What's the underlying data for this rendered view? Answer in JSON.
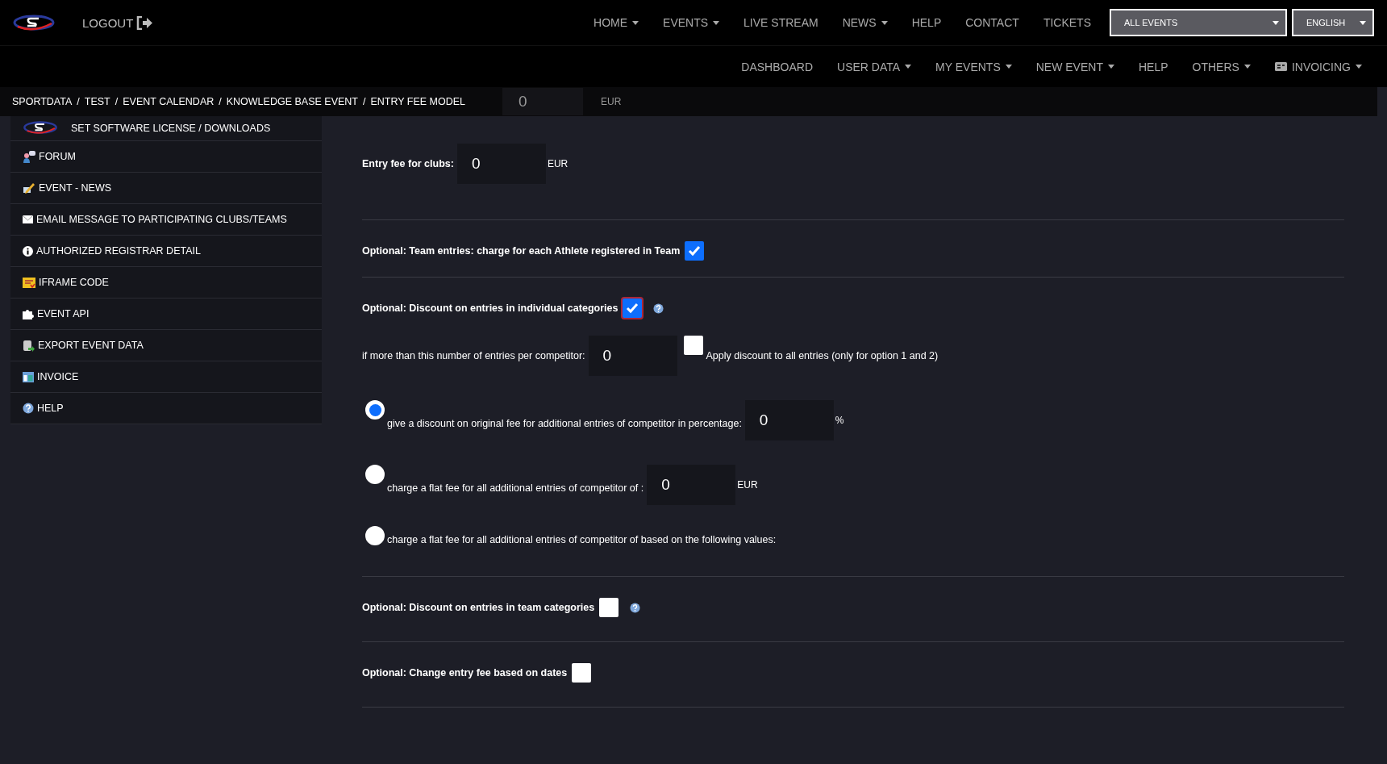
{
  "top_nav": {
    "logout": "LOGOUT",
    "items": [
      {
        "label": "HOME",
        "dropdown": true
      },
      {
        "label": "EVENTS",
        "dropdown": true
      },
      {
        "label": "LIVE STREAM",
        "dropdown": false
      },
      {
        "label": "NEWS",
        "dropdown": true
      },
      {
        "label": "HELP",
        "dropdown": false
      },
      {
        "label": "CONTACT",
        "dropdown": false
      },
      {
        "label": "TICKETS",
        "dropdown": false
      }
    ],
    "event_select": "ALL EVENTS",
    "language_select": "ENGLISH"
  },
  "sub_nav": [
    {
      "label": "DASHBOARD",
      "dropdown": false
    },
    {
      "label": "USER DATA",
      "dropdown": true
    },
    {
      "label": "MY EVENTS",
      "dropdown": true
    },
    {
      "label": "NEW EVENT",
      "dropdown": true
    },
    {
      "label": "HELP",
      "dropdown": false
    },
    {
      "label": "OTHERS",
      "dropdown": true
    },
    {
      "label": "INVOICING",
      "dropdown": true,
      "kind": "invoice"
    }
  ],
  "breadcrumb_separator": "/",
  "breadcrumbs": [
    "SPORTDATA",
    "TEST",
    "EVENT CALENDAR",
    "KNOWLEDGE BASE EVENT",
    "ENTRY FEE MODEL"
  ],
  "sidebar": [
    {
      "label": "SET SOFTWARE LICENSE / DOWNLOADS",
      "kind": "logo"
    },
    {
      "label": "FORUM",
      "kind": "forum"
    },
    {
      "label": "EVENT - NEWS",
      "kind": "pencil"
    },
    {
      "label": "EMAIL MESSAGE TO PARTICIPATING CLUBS/TEAMS",
      "kind": "mail"
    },
    {
      "label": "AUTHORIZED REGISTRAR DETAIL",
      "kind": "info"
    },
    {
      "label": "IFRAME CODE",
      "kind": "code"
    },
    {
      "label": "EVENT API",
      "kind": "puzzle"
    },
    {
      "label": "EXPORT EVENT DATA",
      "kind": "export"
    },
    {
      "label": "INVOICE",
      "kind": "table"
    },
    {
      "label": "HELP",
      "kind": "help"
    }
  ],
  "form": {
    "officials_fee": {
      "value": "0",
      "unit": "EUR"
    },
    "clubs_fee": {
      "label": "Entry fee for clubs:",
      "value": "0",
      "unit": "EUR"
    },
    "team_entries": {
      "label": "Optional: Team entries: charge for each Athlete registered in Team",
      "checked": true
    },
    "individual_discount": {
      "label": "Optional: Discount on entries in individual categories",
      "checked": true,
      "focused": true
    },
    "threshold": {
      "label": "if more than this number of entries per competitor:",
      "value": "0",
      "apply_label": "Apply discount to all entries (only for option 1 and 2)",
      "apply_checked": false
    },
    "options": [
      {
        "label": "give a discount on original fee for additional entries of competitor in percentage:",
        "selected": true,
        "value": "0",
        "unit": "%"
      },
      {
        "label": "charge a flat fee for all additional entries of competitor of :",
        "selected": false,
        "value": "0",
        "unit": "EUR"
      },
      {
        "label": "charge a flat fee for all additional entries of competitor of based on the following values:",
        "selected": false
      }
    ],
    "team_discount": {
      "label": "Optional: Discount on entries in team categories",
      "checked": false
    },
    "date_fee": {
      "label": "Optional: Change entry fee based on dates",
      "checked": false
    }
  }
}
